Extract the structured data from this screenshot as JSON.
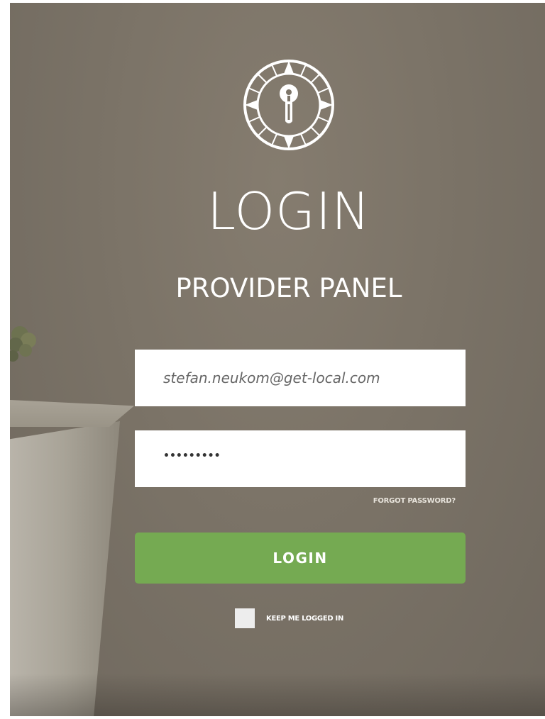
{
  "brand": {
    "logo_icon": "compass-key-icon"
  },
  "header": {
    "title": "LOGIN",
    "subtitle": "PROVIDER PANEL"
  },
  "form": {
    "email_value": "stefan.neukom@get-local.com",
    "password_masked": "•••••••••",
    "forgot_password_label": "FORGOT PASSWORD?",
    "login_button_label": "LOGIN",
    "keep_logged_in_label": "KEEP ME LOGGED IN",
    "keep_logged_in_checked": false
  },
  "colors": {
    "background": "#7b7367",
    "accent_green": "#75aa52",
    "text": "#ffffff"
  }
}
